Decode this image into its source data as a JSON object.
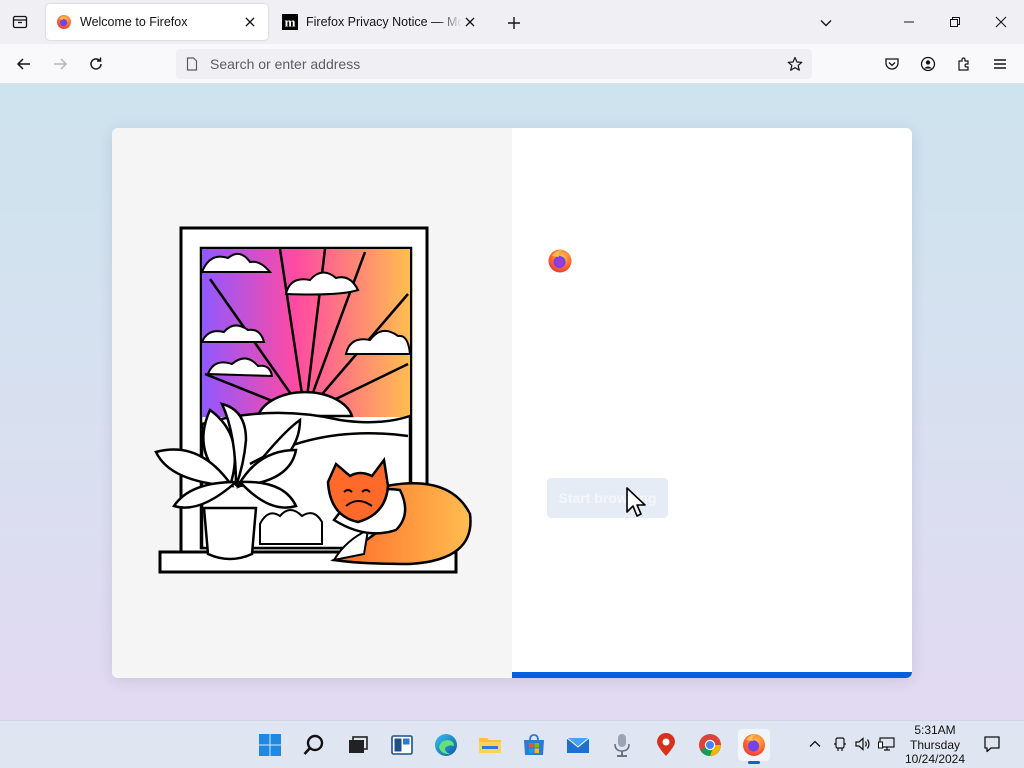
{
  "browser": {
    "tabs": [
      {
        "title": "Welcome to Firefox",
        "active": true,
        "favicon": "firefox-icon"
      },
      {
        "title": "Firefox Privacy Notice — Mozilla",
        "active": false,
        "favicon": "mozilla-m-icon"
      }
    ],
    "urlbar": {
      "placeholder": "Search or enter address",
      "value": ""
    }
  },
  "page": {
    "start_button_label": "Start browsing",
    "progress_percent": 100,
    "accent": "#0060df"
  },
  "taskbar": {
    "time": "5:31AM",
    "day": "Thursday",
    "date": "10/24/2024",
    "pinned": [
      "windows-start-icon",
      "search-icon",
      "task-view-icon",
      "widgets-icon",
      "edge-icon",
      "file-explorer-icon",
      "microsoft-store-icon",
      "mail-icon",
      "microphone-app-icon",
      "maps-pin-icon",
      "chrome-icon",
      "firefox-icon"
    ]
  }
}
